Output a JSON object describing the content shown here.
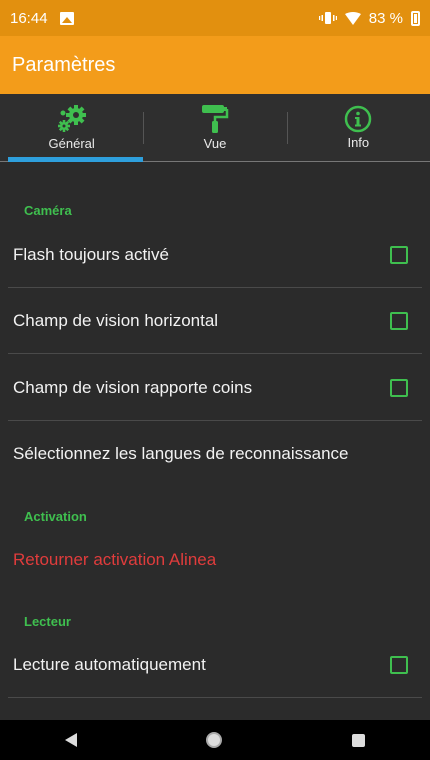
{
  "status_bar": {
    "time": "16:44",
    "battery": "83 %",
    "icons": [
      "image-notification-icon",
      "vibrate-icon",
      "wifi-icon",
      "battery-icon"
    ]
  },
  "app_bar": {
    "title": "Paramètres"
  },
  "tabs": [
    {
      "label": "Général",
      "icon": "gears-icon",
      "active": true
    },
    {
      "label": "Vue",
      "icon": "paint-roller-icon",
      "active": false
    },
    {
      "label": "Info",
      "icon": "info-icon",
      "active": false
    }
  ],
  "sections": {
    "camera": {
      "header": "Caméra",
      "items": [
        {
          "label": "Flash toujours activé",
          "checked": false
        },
        {
          "label": "Champ de vision horizontal",
          "checked": false
        },
        {
          "label": "Champ de vision rapporte coins",
          "checked": false
        },
        {
          "label": "Sélectionnez les langues de reconnaissance"
        }
      ]
    },
    "activation": {
      "header": "Activation",
      "items": [
        {
          "label": "Retourner activation Alinea"
        }
      ]
    },
    "lecteur": {
      "header": "Lecteur",
      "items": [
        {
          "label": "Lecture automatiquement",
          "checked": false
        }
      ]
    }
  },
  "colors": {
    "status_bar": "#e2900f",
    "app_bar": "#f39c1a",
    "accent_green": "#3fbf4f",
    "tab_indicator": "#2e9fdc",
    "danger": "#e03c3c",
    "background": "#2b2b2b"
  },
  "nav_bar": {
    "icons": [
      "back-icon",
      "home-icon",
      "recents-icon"
    ]
  }
}
